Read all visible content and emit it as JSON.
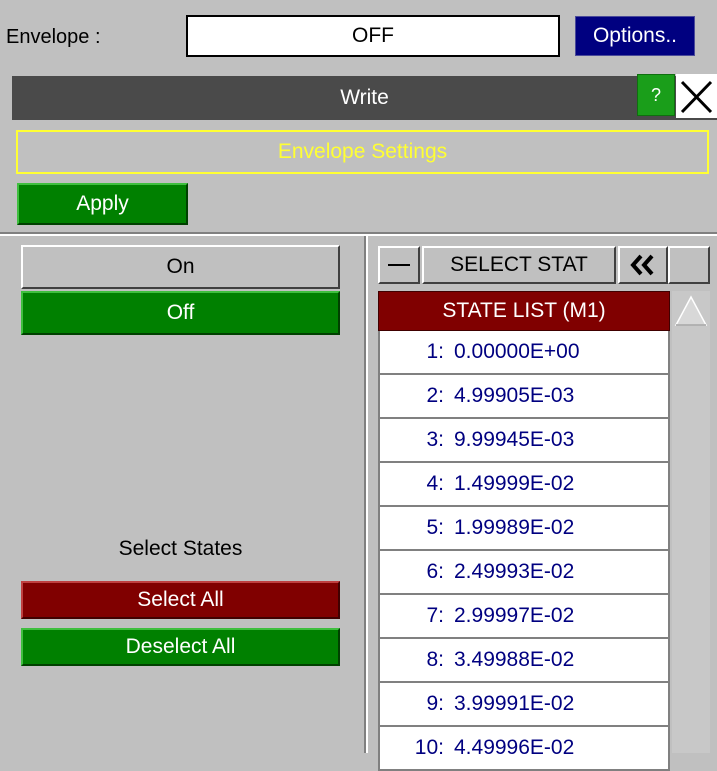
{
  "envelope": {
    "label": "Envelope :",
    "value": "OFF",
    "options_label": "Options.."
  },
  "panel": {
    "title": "Write",
    "help_label": "?",
    "settings_label": "Envelope Settings",
    "apply_label": "Apply"
  },
  "left": {
    "on_label": "On",
    "off_label": "Off",
    "select_states_label": "Select States",
    "select_all_label": "Select All",
    "deselect_all_label": "Deselect All"
  },
  "right": {
    "select_stat_label": "SELECT STAT",
    "list_header": "STATE LIST (M1)",
    "states": [
      {
        "index": "1:",
        "value": "0.00000E+00"
      },
      {
        "index": "2:",
        "value": "4.99905E-03"
      },
      {
        "index": "3:",
        "value": "9.99945E-03"
      },
      {
        "index": "4:",
        "value": "1.49999E-02"
      },
      {
        "index": "5:",
        "value": "1.99989E-02"
      },
      {
        "index": "6:",
        "value": "2.49993E-02"
      },
      {
        "index": "7:",
        "value": "2.99997E-02"
      },
      {
        "index": "8:",
        "value": "3.49988E-02"
      },
      {
        "index": "9:",
        "value": "3.99991E-02"
      },
      {
        "index": "10:",
        "value": "4.49996E-02"
      }
    ]
  },
  "colors": {
    "background": "#c0c0c0",
    "options": "#000080",
    "title_bar": "#4a4a4a",
    "green": "#008000",
    "maroon": "#800000",
    "settings_text": "#ffff33",
    "state_text": "#000080"
  },
  "icons": {
    "close": "close-icon",
    "collapse": "double-chevron-left-icon",
    "scroll_up": "triangle-up-icon"
  }
}
